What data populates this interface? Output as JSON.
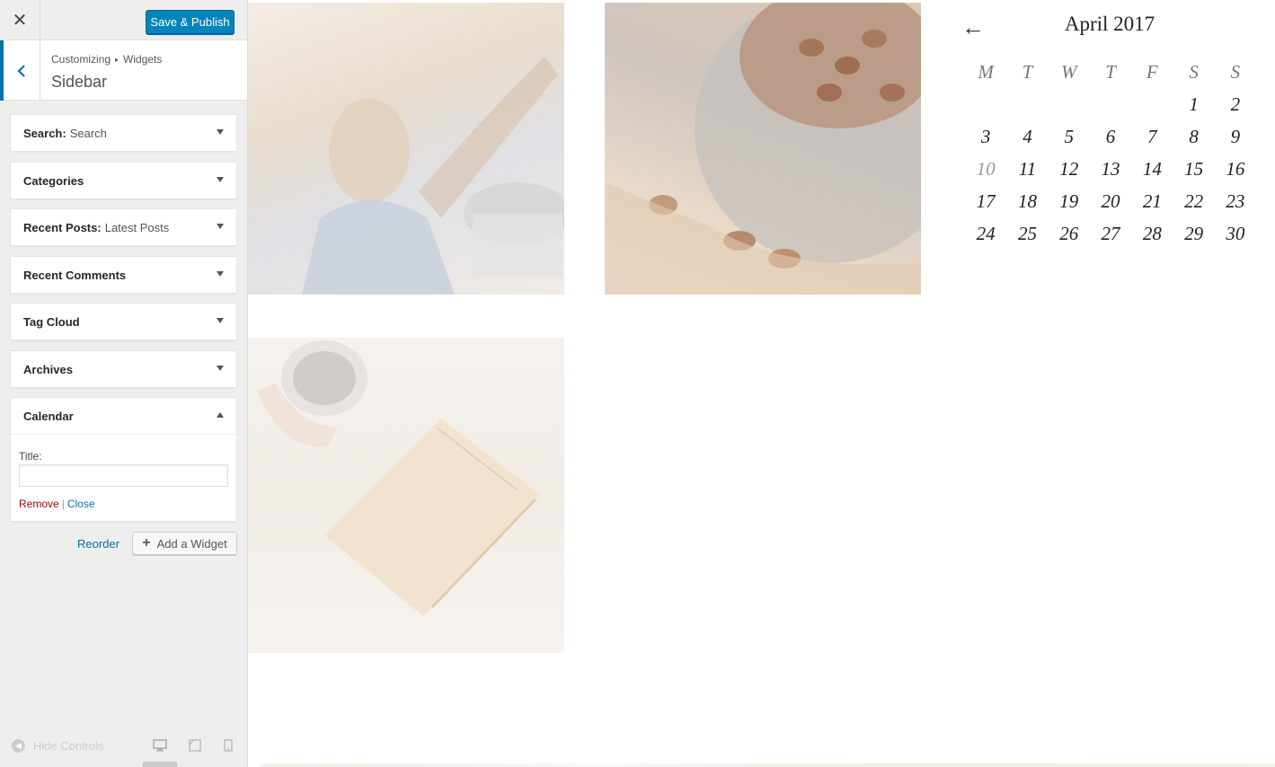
{
  "header": {
    "publish_label": "Save & Publish"
  },
  "section": {
    "breadcrumb_parent": "Customizing",
    "breadcrumb_child": "Widgets",
    "title": "Sidebar"
  },
  "widgets": [
    {
      "name": "Search",
      "subtitle": "Search"
    },
    {
      "name": "Categories",
      "subtitle": ""
    },
    {
      "name": "Recent Posts",
      "subtitle": "Latest Posts"
    },
    {
      "name": "Recent Comments",
      "subtitle": ""
    },
    {
      "name": "Tag Cloud",
      "subtitle": ""
    },
    {
      "name": "Archives",
      "subtitle": ""
    },
    {
      "name": "Calendar",
      "subtitle": ""
    }
  ],
  "calendar_widget": {
    "title_label": "Title:",
    "title_value": "",
    "remove_label": "Remove",
    "separator": "|",
    "close_label": "Close"
  },
  "actions": {
    "reorder_label": "Reorder",
    "add_widget_label": "Add a Widget"
  },
  "footer": {
    "hide_controls_label": "Hide Controls"
  },
  "calendar": {
    "prev_symbol": "←",
    "title": "April 2017",
    "weekdays": [
      "M",
      "T",
      "W",
      "T",
      "F",
      "S",
      "S"
    ],
    "weeks": [
      [
        "",
        "",
        "",
        "",
        "",
        "1",
        "2"
      ],
      [
        "3",
        "4",
        "5",
        "6",
        "7",
        "8",
        "9"
      ],
      [
        "10",
        "11",
        "12",
        "13",
        "14",
        "15",
        "16"
      ],
      [
        "17",
        "18",
        "19",
        "20",
        "21",
        "22",
        "23"
      ],
      [
        "24",
        "25",
        "26",
        "27",
        "28",
        "29",
        "30"
      ]
    ],
    "muted_day": "10"
  },
  "colors": {
    "primary": "#0085ba",
    "link": "#0073aa",
    "remove": "#aa0000"
  }
}
